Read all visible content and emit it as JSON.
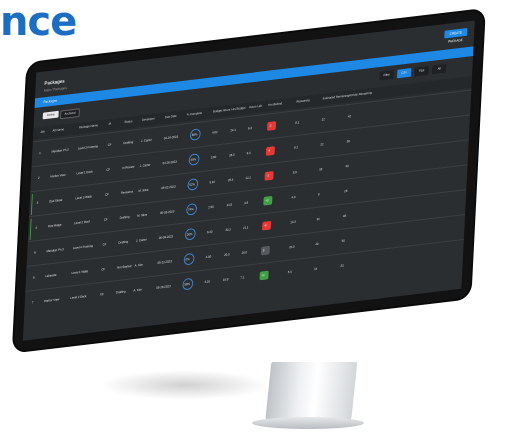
{
  "headline": "nce",
  "colors": {
    "headline": "#1b6ec2",
    "accent_bar": "#1e88e5",
    "ghost_button": "#1e88e5",
    "overdue": "#e53935",
    "on_track": "#43a047",
    "neutral_pill": "#555a5f"
  },
  "app": {
    "title": "Packages",
    "breadcrumb": "Main / Packages",
    "top_button": "CREATE PACKAGE",
    "accent_bar_label": "Packages",
    "tab_active": "Active",
    "tab_archived": "Archived",
    "toolbar": [
      "Filter",
      "CSV",
      "PDF",
      "All"
    ]
  },
  "table": {
    "columns": [
      "Job",
      "Alt Name",
      "Package Name",
      "M",
      "Status",
      "Developer",
      "Due Date",
      "% Complete",
      "Budget Hours",
      "Hrs Budget",
      "Hours Left",
      "Hrs Behind",
      "Remaining",
      "Estimated Remaining",
      "Activity Remaining"
    ]
  },
  "rows": [
    {
      "id": "1",
      "alt": "Meridian Ph 2",
      "pkg": "Level 2 Framing",
      "m": "CF",
      "status": "Drafting",
      "dev": "J. Carter",
      "due": "04-24-2023",
      "pct": "68%",
      "a": "4.82",
      "b": "24.1",
      "c": "6.3",
      "flag": "overdue",
      "flag_text": "-2",
      "e": "8.1",
      "f": "12",
      "g": "42"
    },
    {
      "id": "2",
      "alt": "Harbor View",
      "pkg": "Level 1 Deck",
      "m": "CF",
      "status": "In Review",
      "dev": "J. Carter",
      "due": "04-26-2023",
      "pct": "45%",
      "a": "3.60",
      "b": "18.0",
      "c": "9.4",
      "flag": "overdue",
      "flag_text": "-4",
      "e": "6.2",
      "f": "22",
      "g": "36"
    },
    {
      "id": "3",
      "alt": "Oak Street",
      "pkg": "Level 3 Walls",
      "m": "CF",
      "status": "Revisions",
      "dev": "M. Silva",
      "due": "05-02-2023",
      "pct": "52%",
      "a": "5.10",
      "b": "26.4",
      "c": "12.2",
      "flag": "overdue",
      "flag_text": "-1",
      "e": "9.9",
      "f": "18",
      "g": "40"
    },
    {
      "id": "4",
      "alt": "Pine Ridge",
      "pkg": "Level 2 Roof",
      "m": "CF",
      "status": "Drafting",
      "dev": "M. Silva",
      "due": "05-05-2023",
      "pct": "74%",
      "a": "2.90",
      "b": "14.5",
      "c": "3.8",
      "flag": "on_track",
      "flag_text": "+3",
      "e": "4.0",
      "f": "9",
      "g": "28"
    },
    {
      "id": "5",
      "alt": "Meridian Ph 3",
      "pkg": "Level 4 Framing",
      "m": "CF",
      "status": "Drafting",
      "dev": "J. Carter",
      "due": "05-09-2023",
      "pct": "30%",
      "a": "6.40",
      "b": "30.2",
      "c": "21.1",
      "flag": "overdue",
      "flag_text": "-6",
      "e": "14.3",
      "f": "31",
      "g": "48"
    },
    {
      "id": "6",
      "alt": "Lakeside",
      "pkg": "Level 1 Walls",
      "m": "CF",
      "status": "Not Started",
      "dev": "A. Kim",
      "due": "05-12-2023",
      "pct": "0%",
      "a": "4.00",
      "b": "20.0",
      "c": "20.0",
      "flag": "neutral",
      "flag_text": "0",
      "e": "20.0",
      "f": "40",
      "g": "50"
    },
    {
      "id": "7",
      "alt": "Harbor View",
      "pkg": "Level 2 Deck",
      "m": "CF",
      "status": "Drafting",
      "dev": "A. Kim",
      "due": "05-16-2023",
      "pct": "58%",
      "a": "3.20",
      "b": "16.8",
      "c": "7.1",
      "flag": "on_track",
      "flag_text": "+1",
      "e": "5.4",
      "f": "14",
      "g": "33"
    }
  ]
}
